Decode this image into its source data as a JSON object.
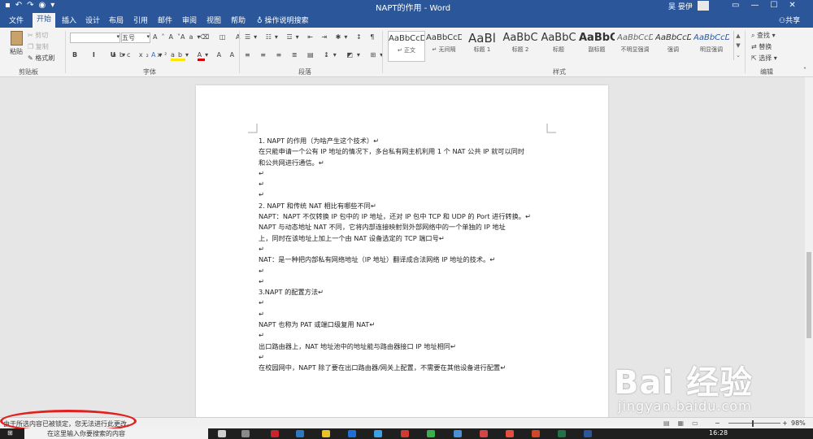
{
  "window": {
    "title": "NAPT的作用 - Word",
    "user": "吴 晏伊"
  },
  "tabs": [
    "文件",
    "开始",
    "插入",
    "设计",
    "布局",
    "引用",
    "邮件",
    "审阅",
    "视图",
    "帮助"
  ],
  "tell_me": "操作说明搜索",
  "share": "共享",
  "clipboard": {
    "paste": "粘贴",
    "cut": "剪切",
    "copy": "复制",
    "format_painter": "格式刷",
    "label": "剪贴板"
  },
  "font": {
    "name_value": "",
    "size_value": "五号",
    "label": "字体"
  },
  "paragraph": {
    "label": "段落"
  },
  "styles": {
    "items": [
      {
        "preview": "AaBbCcDc",
        "name": "↵ 正文"
      },
      {
        "preview": "AaBbCcDc",
        "name": "↵ 无间隔"
      },
      {
        "preview": "AaBl",
        "name": "标题 1"
      },
      {
        "preview": "AaBbC",
        "name": "标题 2"
      },
      {
        "preview": "AaBbC",
        "name": "标题"
      },
      {
        "preview": "AaBbC",
        "name": "副标题"
      },
      {
        "preview": "AaBbCcDc",
        "name": "不明显强调"
      },
      {
        "preview": "AaBbCcDc",
        "name": "强调"
      },
      {
        "preview": "AaBbCcDc",
        "name": "明显强调"
      }
    ],
    "label": "样式"
  },
  "editing": {
    "find": "查找",
    "replace": "替换",
    "select": "选择",
    "label": "编辑"
  },
  "document": {
    "lines": [
      "1.   NAPT 的作用（为啥产生这个技术）↵",
      "在只能申请一个公有 IP 地址的情况下，多台私有网主机利用 1 个 NAT 公共 IP 就可以同时",
      "和公共网进行通信。↵",
      "↵",
      "↵",
      "↵",
      "2.   NAPT 和传统 NAT 相比有哪些不同↵",
      "NAPT：NAPT 不仅转换 IP 包中的 IP 地址，还对 IP 包中 TCP 和 UDP 的 Port 进行转换。↵",
      "          NAPT 与动态地址 NAT 不同，它将内部连接映射到外部网络中的一个单独的 IP 地址",
      "上，同时在该地址上加上一个由 NAT 设备选定的 TCP 端口号↵",
      "↵",
      "NAT：是一种把内部私有网络地址（IP 地址）翻译成合法网络 IP 地址的技术。↵",
      "↵",
      "↵",
      "3.NAPT 的配置方法↵",
      "↵",
      "↵",
      "NAPT 也称为 PAT 或端口级复用 NAT↵",
      "↵",
      "出口路由器上，NAT 地址池中的地址能与路由器接口 IP 地址相同↵",
      "↵",
      "在校园网中，NAPT 除了要在出口路由器/网关上配置，不需要在其他设备进行配置↵"
    ]
  },
  "status": {
    "message": "由于所选内容已被锁定，您无法进行此更改。",
    "zoom": "98%",
    "zoom_level_percent": 98
  },
  "taskbar": {
    "search_placeholder": "在这里输入你要搜索的内容",
    "time": "16:28"
  },
  "watermark": {
    "brand": "Bai 经验",
    "url": "jingyan.baidu.com"
  },
  "colors": {
    "word_blue": "#2b579a",
    "highlight_red": "#e12020"
  }
}
